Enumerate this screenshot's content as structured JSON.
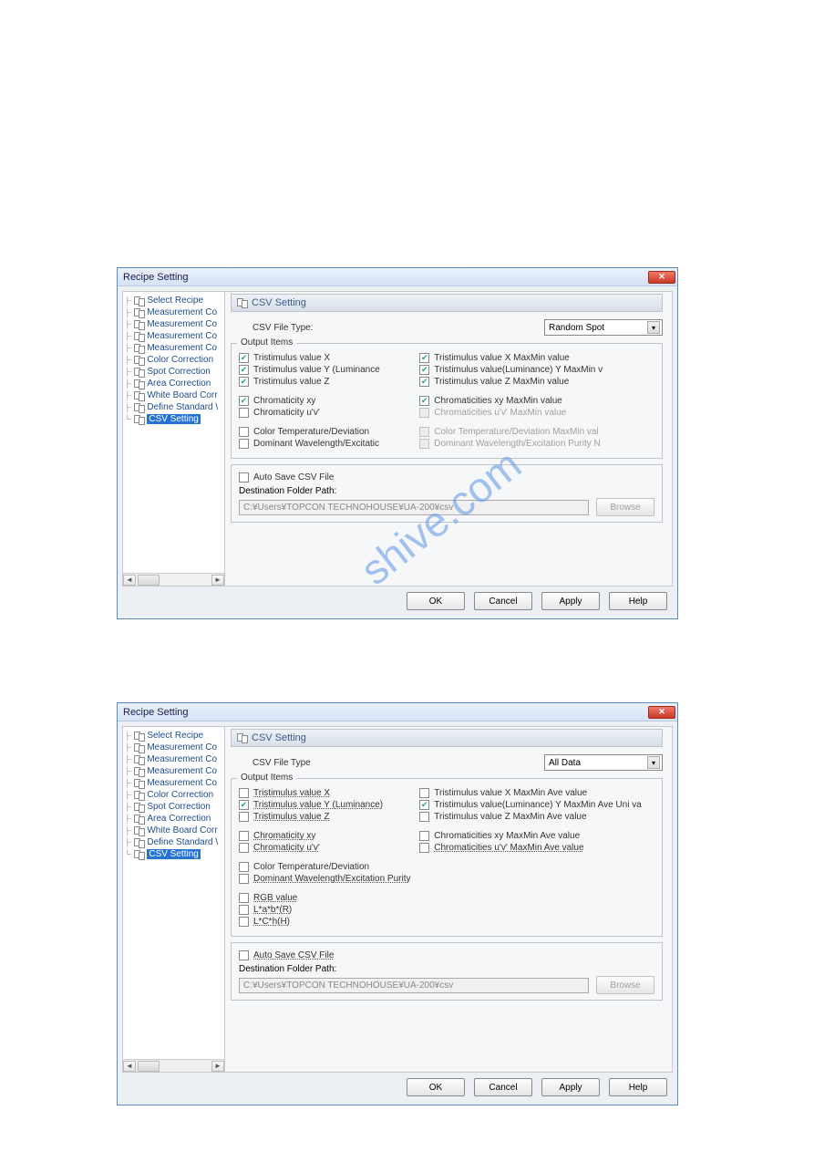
{
  "watermark": "shive.com",
  "dialog1": {
    "title": "Recipe Setting",
    "tree": {
      "items": [
        {
          "label": "Select Recipe",
          "selected": false
        },
        {
          "label": "Measurement Co",
          "selected": false
        },
        {
          "label": "Measurement Co",
          "selected": false
        },
        {
          "label": "Measurement Co",
          "selected": false
        },
        {
          "label": "Measurement Co",
          "selected": false
        },
        {
          "label": "Color Correction",
          "selected": false
        },
        {
          "label": "Spot Correction",
          "selected": false
        },
        {
          "label": "Area Correction",
          "selected": false
        },
        {
          "label": "White Board Corr",
          "selected": false
        },
        {
          "label": "Define Standard \\",
          "selected": false
        },
        {
          "label": "CSV Setting",
          "selected": true
        }
      ]
    },
    "panel": {
      "header": "CSV Setting",
      "file_type_label": "CSV File Type:",
      "file_type_value": "Random Spot",
      "output_group": "Output Items",
      "col1": [
        {
          "label": "Tristimulus value X",
          "checked": true,
          "disabled": false
        },
        {
          "label": "Tristimulus value Y (Luminance",
          "checked": true,
          "disabled": false
        },
        {
          "label": "Tristimulus value Z",
          "checked": true,
          "disabled": false
        },
        {
          "gap": true
        },
        {
          "label": "Chromaticity xy",
          "checked": true,
          "disabled": false
        },
        {
          "label": "Chromaticity u'v'",
          "checked": false,
          "disabled": false
        },
        {
          "gap": true
        },
        {
          "label": "Color Temperature/Deviation",
          "checked": false,
          "disabled": false
        },
        {
          "label": "Dominant Wavelength/Excitatic",
          "checked": false,
          "disabled": false
        }
      ],
      "col2": [
        {
          "label": "Tristimulus value X MaxMin value",
          "checked": true,
          "disabled": false
        },
        {
          "label": "Tristimulus value(Luminance) Y MaxMin v",
          "checked": true,
          "disabled": false
        },
        {
          "label": "Tristimulus value Z MaxMin value",
          "checked": true,
          "disabled": false
        },
        {
          "gap": true
        },
        {
          "label": "Chromaticities xy MaxMin value",
          "checked": true,
          "disabled": false
        },
        {
          "label": "Chromaticities u'v' MaxMin value",
          "checked": false,
          "disabled": true
        },
        {
          "gap": true
        },
        {
          "label": "Color Temperature/Deviation MaxMin val",
          "checked": false,
          "disabled": true
        },
        {
          "label": "Dominant Wavelength/Excitation Purity N",
          "checked": false,
          "disabled": true
        }
      ],
      "autosave_cb": "Auto Save CSV File",
      "dest_label": "Destination Folder Path:",
      "dest_value": "C:¥Users¥TOPCON TECHNOHOUSE¥UA-200¥csv",
      "browse": "Browse"
    },
    "buttons": {
      "ok": "OK",
      "cancel": "Cancel",
      "apply": "Apply",
      "help": "Help"
    }
  },
  "dialog2": {
    "title": "Recipe Setting",
    "tree": {
      "items": [
        {
          "label": "Select Recipe",
          "selected": false
        },
        {
          "label": "Measurement Co",
          "selected": false
        },
        {
          "label": "Measurement Co",
          "selected": false
        },
        {
          "label": "Measurement Co",
          "selected": false
        },
        {
          "label": "Measurement Co",
          "selected": false
        },
        {
          "label": "Color Correction",
          "selected": false
        },
        {
          "label": "Spot Correction",
          "selected": false
        },
        {
          "label": "Area Correction",
          "selected": false
        },
        {
          "label": "White Board Corr",
          "selected": false
        },
        {
          "label": "Define Standard \\",
          "selected": false
        },
        {
          "label": "CSV Setting",
          "selected": true
        }
      ]
    },
    "panel": {
      "header": "CSV Setting",
      "file_type_label": "CSV File Type",
      "file_type_value": "All Data",
      "output_group": "Output Items",
      "col1": [
        {
          "label": "Tristimulus value X",
          "checked": false,
          "disabled": false,
          "dot": true
        },
        {
          "label": "Tristimulus value Y (Luminance)",
          "checked": true,
          "disabled": false,
          "dot": true
        },
        {
          "label": "Tristimulus value Z",
          "checked": false,
          "disabled": false,
          "dot": true
        },
        {
          "gap": true
        },
        {
          "label": "Chromaticity xy",
          "checked": false,
          "disabled": false,
          "dot": true
        },
        {
          "label": "Chromaticity u'v'",
          "checked": false,
          "disabled": false,
          "dot": true
        },
        {
          "gap": true
        },
        {
          "label": "Color Temperature/Deviation",
          "checked": false,
          "disabled": false
        },
        {
          "label": "Dominant Wavelength/Excitation Purity",
          "checked": false,
          "disabled": false,
          "dot": true
        },
        {
          "gap": true
        },
        {
          "label": "RGB value",
          "checked": false,
          "disabled": false,
          "dot": true
        },
        {
          "label": "L*a*b*(R)",
          "checked": false,
          "disabled": false,
          "dot": true
        },
        {
          "label": "L*C*h(H)",
          "checked": false,
          "disabled": false,
          "dot": true
        }
      ],
      "col2": [
        {
          "label": "Tristimulus value X MaxMin Ave value",
          "checked": false,
          "disabled": false
        },
        {
          "label": "Tristimulus value(Luminance) Y MaxMin Ave Uni va",
          "checked": true,
          "disabled": false
        },
        {
          "label": "Tristimulus value Z MaxMin Ave value",
          "checked": false,
          "disabled": false
        },
        {
          "gap": true
        },
        {
          "label": "Chromaticities xy MaxMin Ave value",
          "checked": false,
          "disabled": false
        },
        {
          "label": "Chromaticities u'v' MaxMin Ave value",
          "checked": false,
          "disabled": false,
          "dot": true
        }
      ],
      "autosave_cb": "Auto Save CSV File",
      "dest_label": "Destination Folder Path:",
      "dest_value": "C:¥Users¥TOPCON TECHNOHOUSE¥UA-200¥csv",
      "browse": "Browse"
    },
    "buttons": {
      "ok": "OK",
      "cancel": "Cancel",
      "apply": "Apply",
      "help": "Help"
    }
  }
}
